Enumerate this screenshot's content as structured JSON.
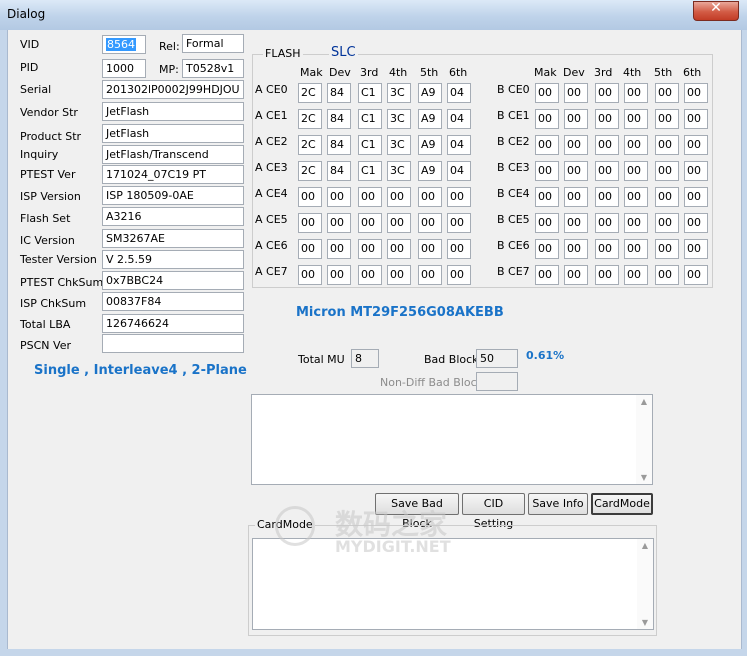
{
  "window": {
    "title": "Dialog",
    "close_glyph": "✕"
  },
  "fields": {
    "vid": {
      "label": "VID",
      "value": "8564"
    },
    "rel": {
      "label": "Rel:",
      "value": "Formal"
    },
    "pid": {
      "label": "PID",
      "value": "1000"
    },
    "mp": {
      "label": "MP:",
      "value": "T0528v1"
    },
    "serial": {
      "label": "Serial",
      "value": "201302lP0002J99HDJOU"
    },
    "vendor": {
      "label": "Vendor Str",
      "value": "JetFlash"
    },
    "product": {
      "label": "Product Str",
      "value": "JetFlash"
    },
    "inquiry": {
      "label": "Inquiry",
      "value": "JetFlash/Transcend"
    },
    "ptest": {
      "label": "PTEST Ver",
      "value": "171024_07C19 PT"
    },
    "isp": {
      "label": "ISP Version",
      "value": "ISP 180509-0AE"
    },
    "flashset": {
      "label": "Flash Set",
      "value": "A3216"
    },
    "ic": {
      "label": "IC Version",
      "value": "SM3267AE"
    },
    "tester": {
      "label": "Tester Version",
      "value": "V 2.5.59"
    },
    "ptestchk": {
      "label": "PTEST ChkSum",
      "value": "0x7BBC24"
    },
    "ispchk": {
      "label": "ISP ChkSum",
      "value": "00837F84"
    },
    "lba": {
      "label": "Total LBA",
      "value": "126746624"
    },
    "pscn": {
      "label": "PSCN Ver",
      "value": ""
    }
  },
  "mode_text": "Single , Interleave4 , 2-Plane",
  "flash": {
    "group_label": "FLASH",
    "cell_type": "SLC",
    "headers": [
      "Mak",
      "Dev",
      "3rd",
      "4th",
      "5th",
      "6th"
    ],
    "a_rows": [
      {
        "label": "A CE0",
        "cells": [
          "2C",
          "84",
          "C1",
          "3C",
          "A9",
          "04"
        ]
      },
      {
        "label": "A CE1",
        "cells": [
          "2C",
          "84",
          "C1",
          "3C",
          "A9",
          "04"
        ]
      },
      {
        "label": "A CE2",
        "cells": [
          "2C",
          "84",
          "C1",
          "3C",
          "A9",
          "04"
        ]
      },
      {
        "label": "A CE3",
        "cells": [
          "2C",
          "84",
          "C1",
          "3C",
          "A9",
          "04"
        ]
      },
      {
        "label": "A CE4",
        "cells": [
          "00",
          "00",
          "00",
          "00",
          "00",
          "00"
        ]
      },
      {
        "label": "A CE5",
        "cells": [
          "00",
          "00",
          "00",
          "00",
          "00",
          "00"
        ]
      },
      {
        "label": "A CE6",
        "cells": [
          "00",
          "00",
          "00",
          "00",
          "00",
          "00"
        ]
      },
      {
        "label": "A CE7",
        "cells": [
          "00",
          "00",
          "00",
          "00",
          "00",
          "00"
        ]
      }
    ],
    "b_rows": [
      {
        "label": "B CE0",
        "cells": [
          "00",
          "00",
          "00",
          "00",
          "00",
          "00"
        ]
      },
      {
        "label": "B CE1",
        "cells": [
          "00",
          "00",
          "00",
          "00",
          "00",
          "00"
        ]
      },
      {
        "label": "B CE2",
        "cells": [
          "00",
          "00",
          "00",
          "00",
          "00",
          "00"
        ]
      },
      {
        "label": "B CE3",
        "cells": [
          "00",
          "00",
          "00",
          "00",
          "00",
          "00"
        ]
      },
      {
        "label": "B CE4",
        "cells": [
          "00",
          "00",
          "00",
          "00",
          "00",
          "00"
        ]
      },
      {
        "label": "B CE5",
        "cells": [
          "00",
          "00",
          "00",
          "00",
          "00",
          "00"
        ]
      },
      {
        "label": "B CE6",
        "cells": [
          "00",
          "00",
          "00",
          "00",
          "00",
          "00"
        ]
      },
      {
        "label": "B CE7",
        "cells": [
          "00",
          "00",
          "00",
          "00",
          "00",
          "00"
        ]
      }
    ]
  },
  "flash_model": "Micron MT29F256G08AKEBB",
  "stats": {
    "total_mu_label": "Total MU",
    "total_mu": "8",
    "bad_block_label": "Bad Block",
    "bad_block": "50",
    "bad_pct": "0.61%",
    "nondiff_label": "Non-Diff Bad Block",
    "nondiff": ""
  },
  "buttons": {
    "save_bad_block": "Save Bad Block",
    "cid_setting": "CID Setting",
    "save_info": "Save Info",
    "card_mode": "CardMode"
  },
  "cardmode_group": "CardMode",
  "watermark": {
    "main": "数码之家",
    "sub": "MYDIGIT.NET"
  },
  "colors": {
    "accent_blue": "#1a73c8",
    "selection": "#3399ff",
    "title_blue": "#003399"
  }
}
